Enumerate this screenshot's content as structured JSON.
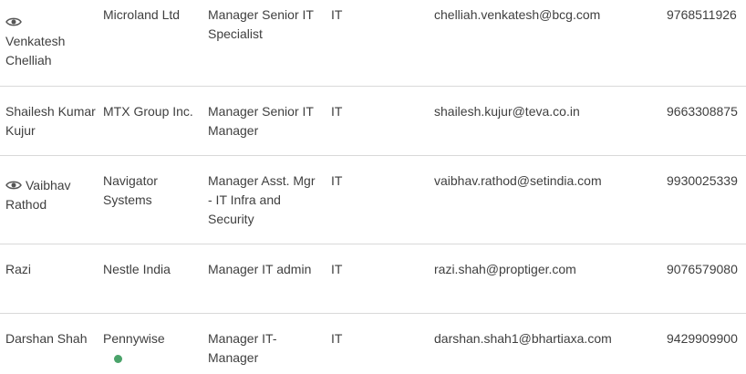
{
  "rows": [
    {
      "name": "Venkatesh Chelliah",
      "company": "Microland Ltd",
      "title": "Manager Senior IT Specialist",
      "department": "IT",
      "email": "chelliah.venkatesh@bcg.com",
      "phone": "9768511926",
      "icon": "eye-icon"
    },
    {
      "name": "Shailesh Kumar Kujur",
      "company": "MTX Group Inc.",
      "title": "Manager Senior IT Manager",
      "department": "IT",
      "email": "shailesh.kujur@teva.co.in",
      "phone": "9663308875"
    },
    {
      "name": "Vaibhav Rathod",
      "company": "Navigator Systems",
      "title": "Manager Asst. Mgr - IT Infra and Security",
      "department": "IT",
      "email": "vaibhav.rathod@setindia.com",
      "phone": "9930025339",
      "icon": "eye-icon"
    },
    {
      "name": "Razi",
      "company": "Nestle India",
      "title": "Manager IT admin",
      "department": "IT",
      "email": "razi.shah@proptiger.com",
      "phone": "9076579080"
    },
    {
      "name": "Darshan Shah",
      "company": "Pennywise",
      "title": "Manager IT- Manager",
      "department": "IT",
      "email": "darshan.shah1@bhartiaxa.com",
      "phone": "9429909900",
      "status_color": "#4aa36a"
    }
  ]
}
